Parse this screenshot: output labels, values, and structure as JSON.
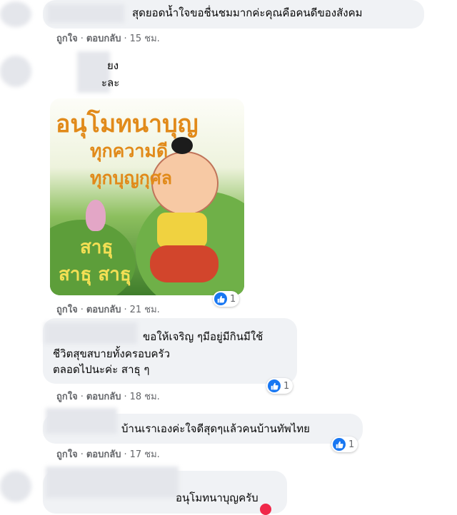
{
  "comments": [
    {
      "id": "c1",
      "lines": [
        "สุดยอดน้ำใจขอชื่นชมมากค่ะคุณคือคนดีของสังคม"
      ],
      "actions": {
        "like": "ถูกใจ",
        "reply": "ตอบกลับ",
        "time": "15 ชม."
      }
    },
    {
      "id": "c2",
      "lines": [
        "ยง",
        "ะละ"
      ],
      "sticker": {
        "title": "อนุโมทนาบุญ",
        "line2": "ทุกความดี",
        "line3": "ทุกบุญกุศล",
        "bottom1": "สาธุ",
        "bottom2": "สาธุ สาธุ"
      },
      "reaction_count": "1",
      "actions": {
        "like": "ถูกใจ",
        "reply": "ตอบกลับ",
        "time": "21 ชม."
      }
    },
    {
      "id": "c3",
      "lines": [
        "ขอให้เจริญ ๆมีอยู่มีกินมีใช้",
        "ชีวิตสุขสบายทั้งครอบครัว",
        "ตลอดไปนะค่ะ สาธุ ๆ"
      ],
      "reaction_count": "1",
      "actions": {
        "like": "ถูกใจ",
        "reply": "ตอบกลับ",
        "time": "18 ชม."
      }
    },
    {
      "id": "c4",
      "lines": [
        "บ้านเราเองค่ะใจดีสุดๆแล้วคนบ้านทัพไทย"
      ],
      "reaction_count": "1",
      "actions": {
        "like": "ถูกใจ",
        "reply": "ตอบกลับ",
        "time": "17 ชม."
      }
    },
    {
      "id": "c5",
      "lines": [
        "อนุโมทนาบุญครับ"
      ]
    }
  ],
  "colors": {
    "like_blue": "#1877f2",
    "bubble": "#f0f2f5",
    "meta": "#65676b"
  },
  "icons": {
    "reaction": "thumbs-up-icon"
  }
}
